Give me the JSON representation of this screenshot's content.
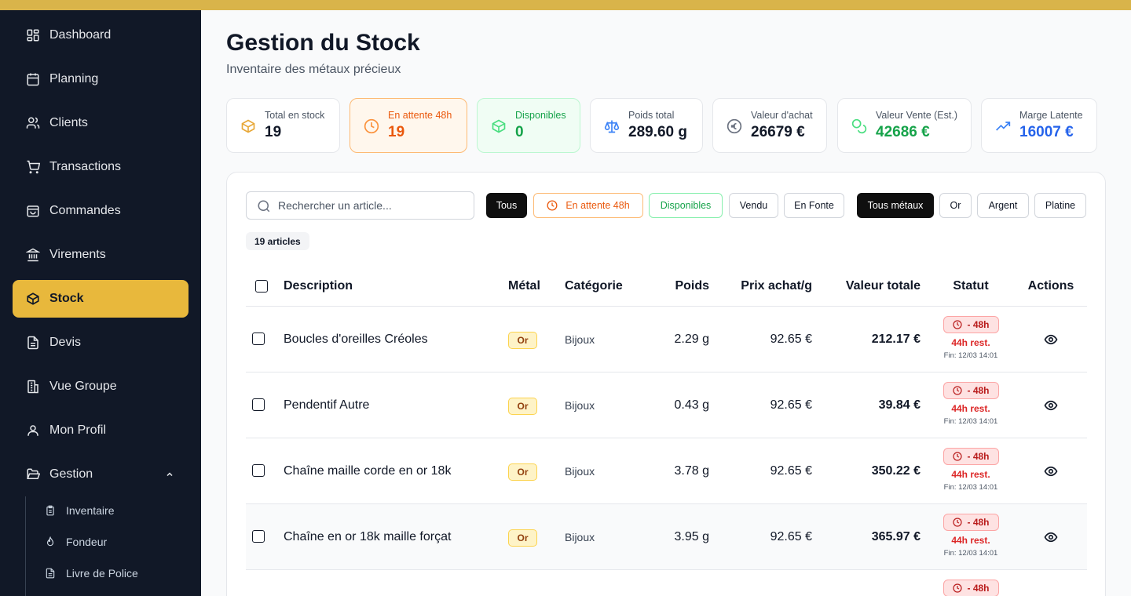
{
  "sidebar": {
    "items": [
      {
        "label": "Dashboard",
        "icon": "dashboard-icon"
      },
      {
        "label": "Planning",
        "icon": "calendar-icon"
      },
      {
        "label": "Clients",
        "icon": "users-icon"
      },
      {
        "label": "Transactions",
        "icon": "cart-icon"
      },
      {
        "label": "Commandes",
        "icon": "shopping-bag-icon"
      },
      {
        "label": "Virements",
        "icon": "bank-icon"
      },
      {
        "label": "Stock",
        "icon": "box-icon",
        "active": true
      },
      {
        "label": "Devis",
        "icon": "document-icon"
      },
      {
        "label": "Vue Groupe",
        "icon": "building-icon"
      },
      {
        "label": "Mon Profil",
        "icon": "user-icon"
      },
      {
        "label": "Gestion",
        "icon": "folder-open-icon",
        "expanded": true
      }
    ],
    "sub_items": [
      {
        "label": "Inventaire",
        "icon": "clipboard-icon"
      },
      {
        "label": "Fondeur",
        "icon": "flame-icon"
      },
      {
        "label": "Livre de Police",
        "icon": "document-icon"
      }
    ]
  },
  "header": {
    "title": "Gestion du Stock",
    "subtitle": "Inventaire des métaux précieux"
  },
  "stats": [
    {
      "label": "Total en stock",
      "value": "19",
      "icon": "box-icon"
    },
    {
      "label": "En attente 48h",
      "value": "19",
      "icon": "clock-icon"
    },
    {
      "label": "Disponibles",
      "value": "0",
      "icon": "box-icon"
    },
    {
      "label": "Poids total",
      "value": "289.60 g",
      "icon": "scale-icon"
    },
    {
      "label": "Valeur d'achat",
      "value": "26679 €",
      "icon": "euro-icon"
    },
    {
      "label": "Valeur Vente (Est.)",
      "value": "42686 €",
      "icon": "coins-icon"
    },
    {
      "label": "Marge Latente",
      "value": "16007 €",
      "icon": "trending-up-icon"
    }
  ],
  "search": {
    "placeholder": "Rechercher un article..."
  },
  "status_filters": [
    "Tous",
    "En attente 48h",
    "Disponibles",
    "Vendu",
    "En Fonte"
  ],
  "metal_filters": [
    "Tous métaux",
    "Or",
    "Argent",
    "Platine"
  ],
  "count_label": "19 articles",
  "table": {
    "headers": [
      "Description",
      "Métal",
      "Catégorie",
      "Poids",
      "Prix achat/g",
      "Valeur totale",
      "Statut",
      "Actions"
    ],
    "rows": [
      {
        "description": "Boucles d'oreilles Créoles",
        "metal": "Or",
        "category": "Bijoux",
        "weight": "2.29 g",
        "price": "92.65 €",
        "total": "212.17 €",
        "status": "- 48h",
        "remaining": "44h rest.",
        "end": "Fin: 12/03 14:01"
      },
      {
        "description": "Pendentif Autre",
        "metal": "Or",
        "category": "Bijoux",
        "weight": "0.43 g",
        "price": "92.65 €",
        "total": "39.84 €",
        "status": "- 48h",
        "remaining": "44h rest.",
        "end": "Fin: 12/03 14:01"
      },
      {
        "description": "Chaîne maille corde en or 18k",
        "metal": "Or",
        "category": "Bijoux",
        "weight": "3.78 g",
        "price": "92.65 €",
        "total": "350.22 €",
        "status": "- 48h",
        "remaining": "44h rest.",
        "end": "Fin: 12/03 14:01"
      },
      {
        "description": "Chaîne en or 18k maille forçat",
        "metal": "Or",
        "category": "Bijoux",
        "weight": "3.95 g",
        "price": "92.65 €",
        "total": "365.97 €",
        "status": "- 48h",
        "remaining": "44h rest.",
        "end": "Fin: 12/03 14:01"
      },
      {
        "description": "",
        "metal": "",
        "category": "",
        "weight": "",
        "price": "",
        "total": "",
        "status": "- 48h",
        "remaining": "",
        "end": ""
      }
    ]
  },
  "colors": {
    "accent": "#e8b83c",
    "sidebar_bg": "#111827",
    "orange": "#ea580c",
    "green": "#16a34a",
    "blue": "#2563eb",
    "danger": "#dc2626"
  }
}
